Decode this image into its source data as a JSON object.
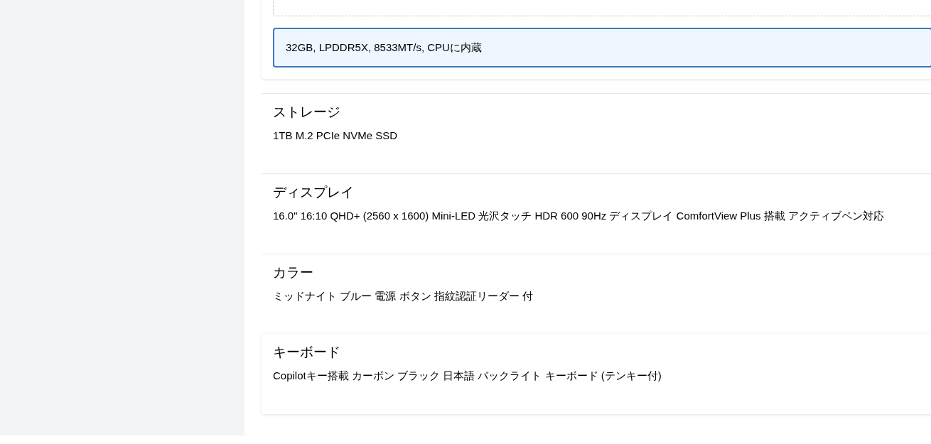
{
  "sections": [
    {
      "kind": "options",
      "highlighted": true,
      "options": [
        {
          "selected": false
        },
        {
          "label": "32GB, LPDDR5X, 8533MT/s, CPUに内蔵",
          "selected": true
        }
      ]
    },
    {
      "kind": "spec",
      "highlighted": false,
      "title": "ストレージ",
      "value": "1TB M.2 PCIe NVMe SSD"
    },
    {
      "kind": "spec",
      "highlighted": false,
      "title": "ディスプレイ",
      "value": "16.0\" 16:10 QHD+ (2560 x 1600) Mini-LED 光沢タッチ HDR 600 90Hz ディスプレイ ComfortView Plus 搭載 アクティブペン対応"
    },
    {
      "kind": "spec",
      "highlighted": false,
      "title": "カラー",
      "value": "ミッドナイト ブルー 電源 ボタン 指紋認証リーダー 付"
    },
    {
      "kind": "spec",
      "highlighted": true,
      "title": "キーボード",
      "value": "Copilotキー搭載 カーボン ブラック 日本語 バックライト キーボード (テンキー付)"
    }
  ]
}
